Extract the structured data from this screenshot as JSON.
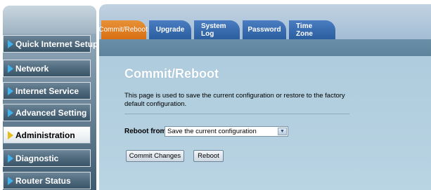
{
  "sidebar": {
    "items": [
      {
        "label": "Quick Internet Setup",
        "active": false
      },
      {
        "label": "Network",
        "active": false
      },
      {
        "label": "Internet Service",
        "active": false
      },
      {
        "label": "Advanced Setting",
        "active": false
      },
      {
        "label": "Administration",
        "active": true
      },
      {
        "label": "Diagnostic",
        "active": false
      },
      {
        "label": "Router Status",
        "active": false
      }
    ]
  },
  "tabs": [
    {
      "label": "Commit/Reboot",
      "active": true
    },
    {
      "label": "Upgrade",
      "active": false
    },
    {
      "label": "System Log",
      "active": false
    },
    {
      "label": "Password",
      "active": false
    },
    {
      "label": "Time Zone",
      "active": false
    }
  ],
  "main": {
    "title": "Commit/Reboot",
    "description": "This page is used to save the current configuration or restore to the factory default configuration.",
    "reboot_from_label": "Reboot from:",
    "reboot_from_value": "Save the current configuration",
    "commit_button": "Commit Changes",
    "reboot_button": "Reboot"
  },
  "colors": {
    "tab_active": "#e07d24",
    "tab_inactive": "#2f63a6",
    "sidebar_arrow": "#3fb2ee",
    "sidebar_arrow_active": "#e9bd18"
  }
}
